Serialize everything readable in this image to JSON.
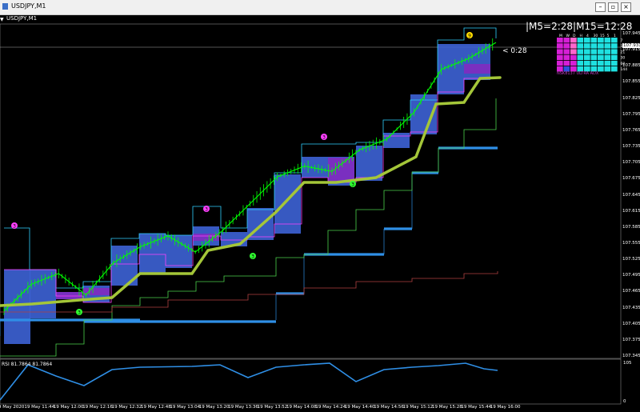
{
  "window": {
    "title": "USDJPY,M1"
  },
  "chart_header": {
    "symbol": "USDJPY,M1"
  },
  "timer_text": "|M5=2:28|M15=12:28",
  "countdown": "< 0:28",
  "adx": {
    "label": "NSK8137 ULTRA ADX",
    "headers": [
      "M",
      "W",
      "D",
      "H",
      "4",
      "30",
      "15",
      "5",
      "1"
    ],
    "row_labels": [
      "7",
      "14",
      "21",
      "30",
      "60",
      "144"
    ],
    "colors": {
      "magenta": "#d61fd6",
      "cyan": "#1fe0e0",
      "pink": "#ff66cc",
      "blue": "#3050e0"
    }
  },
  "price_axis": [
    "107.945",
    "107.915",
    "107.885",
    "107.855",
    "107.825",
    "107.795",
    "107.765",
    "107.735",
    "107.705",
    "107.675",
    "107.645",
    "107.615",
    "107.585",
    "107.555",
    "107.525",
    "107.495",
    "107.465",
    "107.435",
    "107.405",
    "107.375",
    "107.345"
  ],
  "current_price_box": "107.931",
  "current_price_box2": "107.915",
  "rsi": {
    "label": "RSI 81.7864 81.7864",
    "top": "105",
    "bottom": "0"
  },
  "time_axis": [
    "9 May 2020",
    "19 May 11:44",
    "19 May 12:00",
    "19 May 12:16",
    "19 May 12:32",
    "19 May 12:48",
    "19 May 13:04",
    "19 May 13:20",
    "19 May 13:36",
    "19 May 13:52",
    "19 May 14:08",
    "19 May 14:24",
    "19 May 14:40",
    "19 May 14:56",
    "19 May 15:12",
    "19 May 15:28",
    "19 May 15:44",
    "19 May 16:00"
  ],
  "markers": [
    "3",
    "3",
    "3",
    "3",
    "3",
    "3",
    "9"
  ],
  "chart_data": {
    "type": "line",
    "ylim": [
      107.345,
      107.975
    ],
    "series": [
      {
        "values": [
          107.43,
          107.48,
          107.5,
          107.46,
          107.52,
          107.55,
          107.57,
          107.54,
          107.58,
          107.63,
          107.68,
          107.7,
          107.69,
          107.73,
          107.75,
          107.8,
          107.88,
          107.9,
          107.93
        ]
      }
    ]
  }
}
